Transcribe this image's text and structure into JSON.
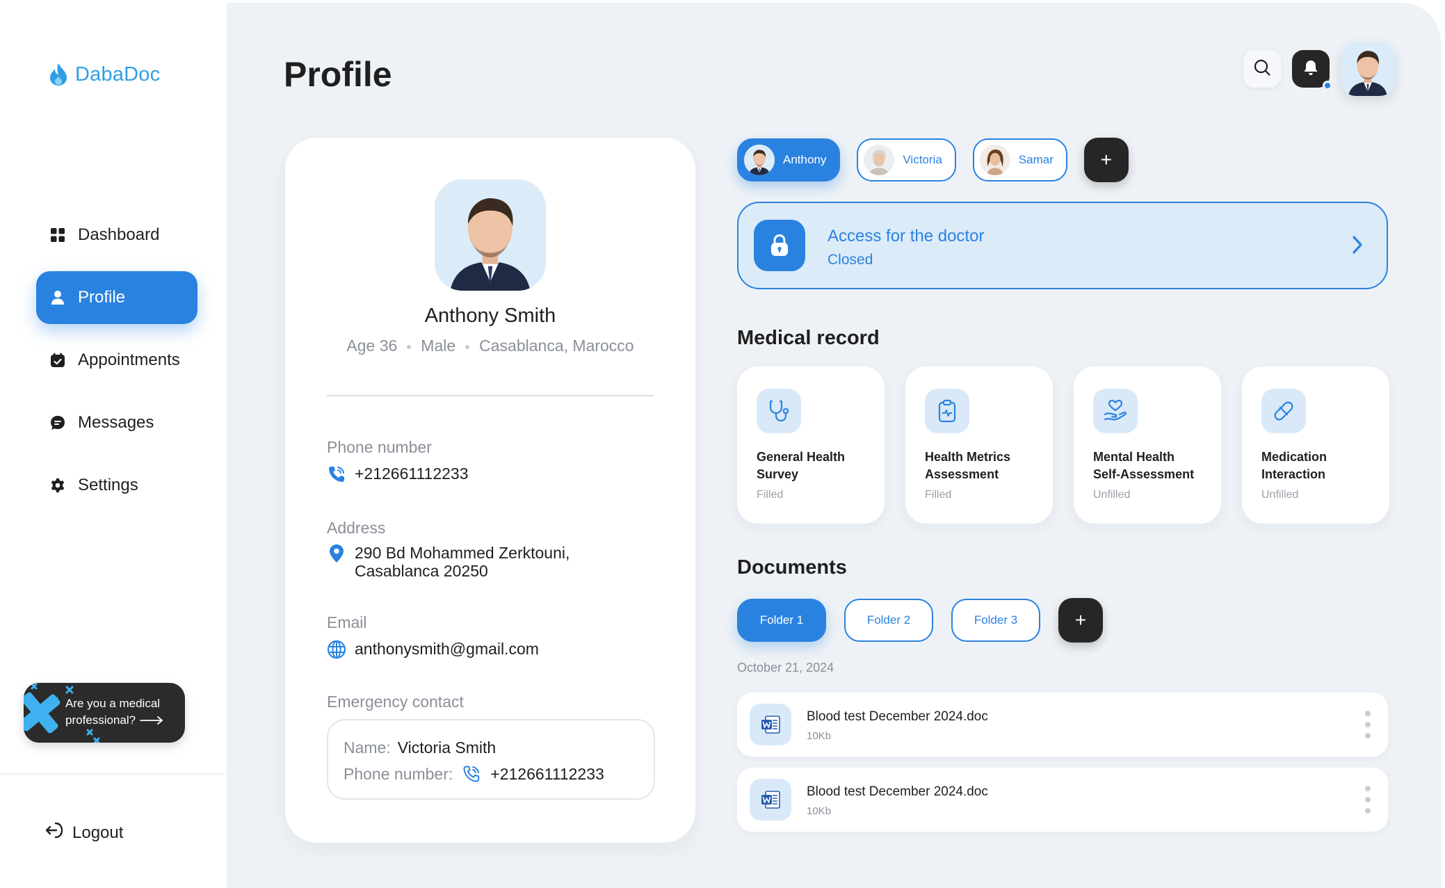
{
  "app": {
    "name": "DabaDoc",
    "brand_color": "#2f9ee6",
    "accent_color": "#2a82e0"
  },
  "sidebar": {
    "items": [
      {
        "label": "Dashboard",
        "icon": "grid-icon",
        "active": false
      },
      {
        "label": "Profile",
        "icon": "user-icon",
        "active": true
      },
      {
        "label": "Appointments",
        "icon": "calendar-icon",
        "active": false
      },
      {
        "label": "Messages",
        "icon": "chat-icon",
        "active": false
      },
      {
        "label": "Settings",
        "icon": "gear-icon",
        "active": false
      }
    ],
    "promo": {
      "line1": "Are you a medical",
      "line2": "professional?"
    },
    "logout_label": "Logout"
  },
  "header": {
    "title": "Profile"
  },
  "profile": {
    "name": "Anthony Smith",
    "age": "Age 36",
    "gender": "Male",
    "location": "Casablanca, Marocco",
    "phone_label": "Phone number",
    "phone": "+212661112233",
    "address_label": "Address",
    "address_line1": "290 Bd Mohammed Zerktouni,",
    "address_line2": "Casablanca 20250",
    "email_label": "Email",
    "email": "anthonysmith@gmail.com",
    "emergency_label": "Emergency contact",
    "emergency": {
      "name_label": "Name:",
      "name": "Victoria Smith",
      "phone_label": "Phone number:",
      "phone": "+212661112233"
    }
  },
  "members": [
    {
      "name": "Anthony",
      "active": true
    },
    {
      "name": "Victoria",
      "active": false
    },
    {
      "name": "Samar",
      "active": false
    }
  ],
  "add_symbol": "+",
  "access": {
    "title": "Access for the doctor",
    "status": "Closed"
  },
  "medical_record": {
    "title": "Medical record",
    "items": [
      {
        "line1": "General Health",
        "line2": "Survey",
        "status": "Filled",
        "icon": "stethoscope-icon"
      },
      {
        "line1": "Health Metrics",
        "line2": "Assessment",
        "status": "Filled",
        "icon": "clipboard-icon"
      },
      {
        "line1": "Mental Health",
        "line2": "Self-Assessment",
        "status": "Unfilled",
        "icon": "heart-hand-icon"
      },
      {
        "line1": "Medication",
        "line2": "Interaction",
        "status": "Unfilled",
        "icon": "pill-icon"
      }
    ]
  },
  "documents": {
    "title": "Documents",
    "folders": [
      {
        "label": "Folder 1",
        "active": true
      },
      {
        "label": "Folder 2",
        "active": false
      },
      {
        "label": "Folder 3",
        "active": false
      }
    ],
    "date": "October 21, 2024",
    "files": [
      {
        "name": "Blood test December 2024.doc",
        "size": "10Kb",
        "icon": "word-doc-icon"
      },
      {
        "name": "Blood test December 2024.doc",
        "size": "10Kb",
        "icon": "word-doc-icon"
      }
    ]
  }
}
